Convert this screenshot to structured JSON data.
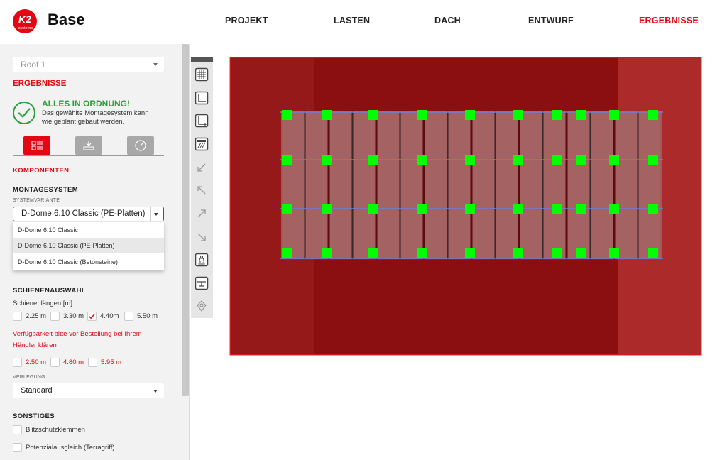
{
  "header": {
    "logo_text": "K2",
    "logo_sub": "systems",
    "brand": "Base",
    "nav": [
      {
        "label": "PROJEKT",
        "active": false
      },
      {
        "label": "LASTEN",
        "active": false
      },
      {
        "label": "DACH",
        "active": false
      },
      {
        "label": "ENTWURF",
        "active": false
      },
      {
        "label": "ERGEBNISSE",
        "active": true
      }
    ]
  },
  "sidebar": {
    "roof_select": "Roof 1",
    "results_title": "ERGEBNISSE",
    "status": {
      "title": "ALLES IN ORDNUNG!",
      "text_line1": "Das gewählte Montagesystem kann",
      "text_line2": "wie geplant gebaut werden."
    },
    "tabs": [
      "components-tab",
      "rail-tab",
      "gauge-tab"
    ],
    "komponenten_title": "KOMPONENTEN",
    "montagesystem_title": "MONTAGESYSTEM",
    "systemvariante_label": "SYSTEMVARIANTE",
    "systemvariante_value": "D-Dome 6.10 Classic (PE-Platten)",
    "dropdown_options": [
      {
        "label": "D-Dome 6.10 Classic",
        "highlighted": false
      },
      {
        "label": "D-Dome 6.10 Classic (PE-Platten)",
        "highlighted": true
      },
      {
        "label": "D-Dome 6.10 Classic (Betonsteine)",
        "highlighted": false
      }
    ],
    "schienenauswahl_title": "SCHIENENAUSWAHL",
    "schienenlaengen_label": "Schienenlängen [m]",
    "lengths_row1": [
      {
        "label": "2.25 m",
        "checked": false
      },
      {
        "label": "3.30 m",
        "checked": false
      },
      {
        "label": "4.40m",
        "checked": true
      },
      {
        "label": "5.50 m",
        "checked": false
      }
    ],
    "availability_line1": "Verfügbarkeit bitte vor Bestellung bei Ihrem",
    "availability_line2": "Händler klären",
    "lengths_row2": [
      {
        "label": "2.50 m",
        "checked": false
      },
      {
        "label": "4.80 m",
        "checked": false
      },
      {
        "label": "5.95 m",
        "checked": false
      }
    ],
    "verlegung_label": "VERLEGUNG",
    "verlegung_value": "Standard",
    "sonstiges_title": "SONSTIGES",
    "extras": [
      {
        "label": "Blitzschutzklemmen",
        "checked": false
      },
      {
        "label": "Potenzialausgleich (Terragriff)",
        "checked": false
      }
    ]
  },
  "toolbar": {
    "tools": [
      "grid-icon",
      "ruler-corner-icon",
      "ruler-point-icon",
      "hatch-icon",
      "arrow-down-left-icon",
      "arrow-up-left-icon",
      "arrow-up-right-icon",
      "arrow-down-right-icon",
      "weight-kg-icon",
      "rail-icon",
      "location-icon"
    ],
    "kg_label": "KG"
  },
  "colors": {
    "accent": "#e30613",
    "roof_dark": "#8b0f10",
    "roof_mid": "#96191a",
    "roof_light": "#ad2a2a",
    "panel": "#a56262",
    "clamp": "#00ff00",
    "rail": "#6a7fd0"
  }
}
